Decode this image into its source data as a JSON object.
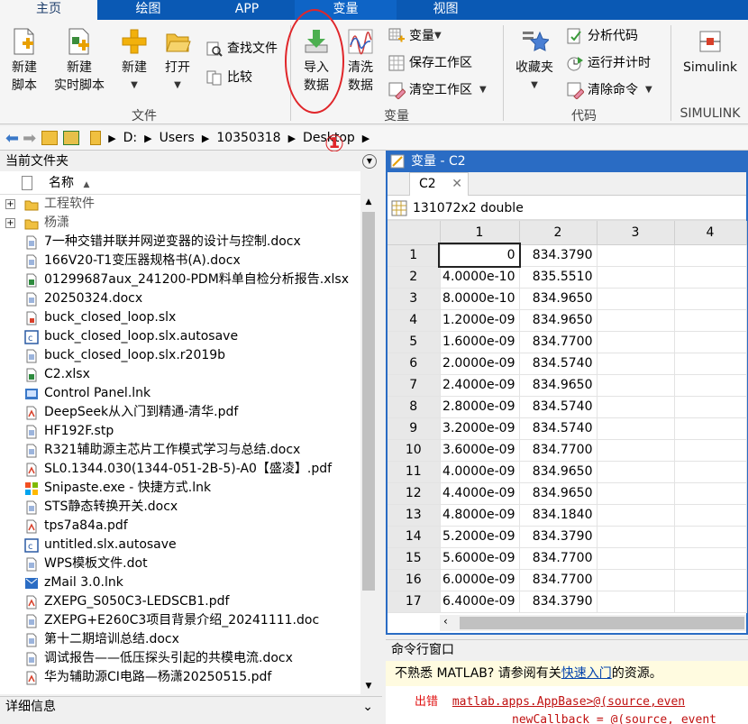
{
  "tabs": [
    "主页",
    "绘图",
    "APP",
    "变量",
    "视图"
  ],
  "ribbon": {
    "new_script": "新建\n脚本",
    "new_live_script": "新建\n实时脚本",
    "new": "新建",
    "open": "打开",
    "find_files": "查找文件",
    "compare": "比较",
    "group_file": "文件",
    "import_data": "导入\n数据",
    "clean_data": "清洗\n数据",
    "variable": "变量",
    "save_workspace": "保存工作区",
    "clear_workspace": "清空工作区",
    "group_variable": "变量",
    "favorites": "收藏夹",
    "analyze_code": "分析代码",
    "run_and_time": "运行并计时",
    "clear_commands": "清除命令",
    "group_code": "代码",
    "simulink": "Simulink",
    "group_simulink": "SIMULINK",
    "annotation": "①"
  },
  "address": {
    "segments": [
      "D:",
      "Users",
      "10350318",
      "Desktop"
    ]
  },
  "current_folder": {
    "title": "当前文件夹",
    "column_name": "名称",
    "files": [
      {
        "name": "工程软件",
        "type": "folder"
      },
      {
        "name": "杨潇",
        "type": "folder"
      },
      {
        "name": "7一种交错并联并网逆变器的设计与控制.docx",
        "type": "docx"
      },
      {
        "name": "166V20-T1变压器规格书(A).docx",
        "type": "docx"
      },
      {
        "name": "01299687aux_241200-PDM料单自检分析报告.xlsx",
        "type": "xlsx"
      },
      {
        "name": "20250324.docx",
        "type": "docx"
      },
      {
        "name": "buck_closed_loop.slx",
        "type": "slx"
      },
      {
        "name": "buck_closed_loop.slx.autosave",
        "type": "autosave"
      },
      {
        "name": "buck_closed_loop.slx.r2019b",
        "type": "docx"
      },
      {
        "name": "C2.xlsx",
        "type": "xlsx"
      },
      {
        "name": "Control Panel.lnk",
        "type": "lnk"
      },
      {
        "name": "DeepSeek从入门到精通-清华.pdf",
        "type": "pdf"
      },
      {
        "name": "HF192F.stp",
        "type": "docx"
      },
      {
        "name": "R321辅助源主芯片工作模式学习与总结.docx",
        "type": "docx"
      },
      {
        "name": "SL0.1344.030(1344-051-2B-5)-A0【盛凌】.pdf",
        "type": "pdf"
      },
      {
        "name": "Snipaste.exe - 快捷方式.lnk",
        "type": "snip"
      },
      {
        "name": "STS静态转换开关.docx",
        "type": "docx"
      },
      {
        "name": "tps7a84a.pdf",
        "type": "pdf"
      },
      {
        "name": "untitled.slx.autosave",
        "type": "autosave"
      },
      {
        "name": "WPS模板文件.dot",
        "type": "docx"
      },
      {
        "name": "zMail 3.0.lnk",
        "type": "mail"
      },
      {
        "name": "ZXEPG_S050C3-LEDSCB1.pdf",
        "type": "pdf"
      },
      {
        "name": "ZXEPG+E260C3项目背景介绍_20241111.doc",
        "type": "docx"
      },
      {
        "name": "第十二期培训总结.docx",
        "type": "docx"
      },
      {
        "name": "调试报告——低压探头引起的共模电流.docx",
        "type": "docx"
      },
      {
        "name": "华为辅助源CI电路—杨潇20250515.pdf",
        "type": "pdf"
      }
    ]
  },
  "details": {
    "title": "详细信息"
  },
  "variables": {
    "title": "变量 - C2",
    "tab_name": "C2",
    "size_info": "131072x2 double",
    "columns": [
      "1",
      "2",
      "3",
      "4"
    ],
    "rows": [
      {
        "idx": "1",
        "c1": "0",
        "c2": "834.3790"
      },
      {
        "idx": "2",
        "c1": "4.0000e-10",
        "c2": "835.5510"
      },
      {
        "idx": "3",
        "c1": "8.0000e-10",
        "c2": "834.9650"
      },
      {
        "idx": "4",
        "c1": "1.2000e-09",
        "c2": "834.9650"
      },
      {
        "idx": "5",
        "c1": "1.6000e-09",
        "c2": "834.7700"
      },
      {
        "idx": "6",
        "c1": "2.0000e-09",
        "c2": "834.5740"
      },
      {
        "idx": "7",
        "c1": "2.4000e-09",
        "c2": "834.9650"
      },
      {
        "idx": "8",
        "c1": "2.8000e-09",
        "c2": "834.5740"
      },
      {
        "idx": "9",
        "c1": "3.2000e-09",
        "c2": "834.5740"
      },
      {
        "idx": "10",
        "c1": "3.6000e-09",
        "c2": "834.7700"
      },
      {
        "idx": "11",
        "c1": "4.0000e-09",
        "c2": "834.9650"
      },
      {
        "idx": "12",
        "c1": "4.4000e-09",
        "c2": "834.9650"
      },
      {
        "idx": "13",
        "c1": "4.8000e-09",
        "c2": "834.1840"
      },
      {
        "idx": "14",
        "c1": "5.2000e-09",
        "c2": "834.3790"
      },
      {
        "idx": "15",
        "c1": "5.6000e-09",
        "c2": "834.7700"
      },
      {
        "idx": "16",
        "c1": "6.0000e-09",
        "c2": "834.7700"
      },
      {
        "idx": "17",
        "c1": "6.4000e-09",
        "c2": "834.3790"
      }
    ]
  },
  "command_window": {
    "title": "命令行窗口",
    "notice_prefix": "不熟悉 MATLAB? 请参阅有关",
    "notice_link": "快速入门",
    "notice_suffix": "的资源。",
    "error_label": "出错",
    "error_link": "matlab.apps.AppBase>@(source,even",
    "code_line": "newCallback = @(source, event"
  },
  "colors": {
    "accent": "#0a59b4",
    "annotation": "#e0262a",
    "link": "#0645ad"
  }
}
